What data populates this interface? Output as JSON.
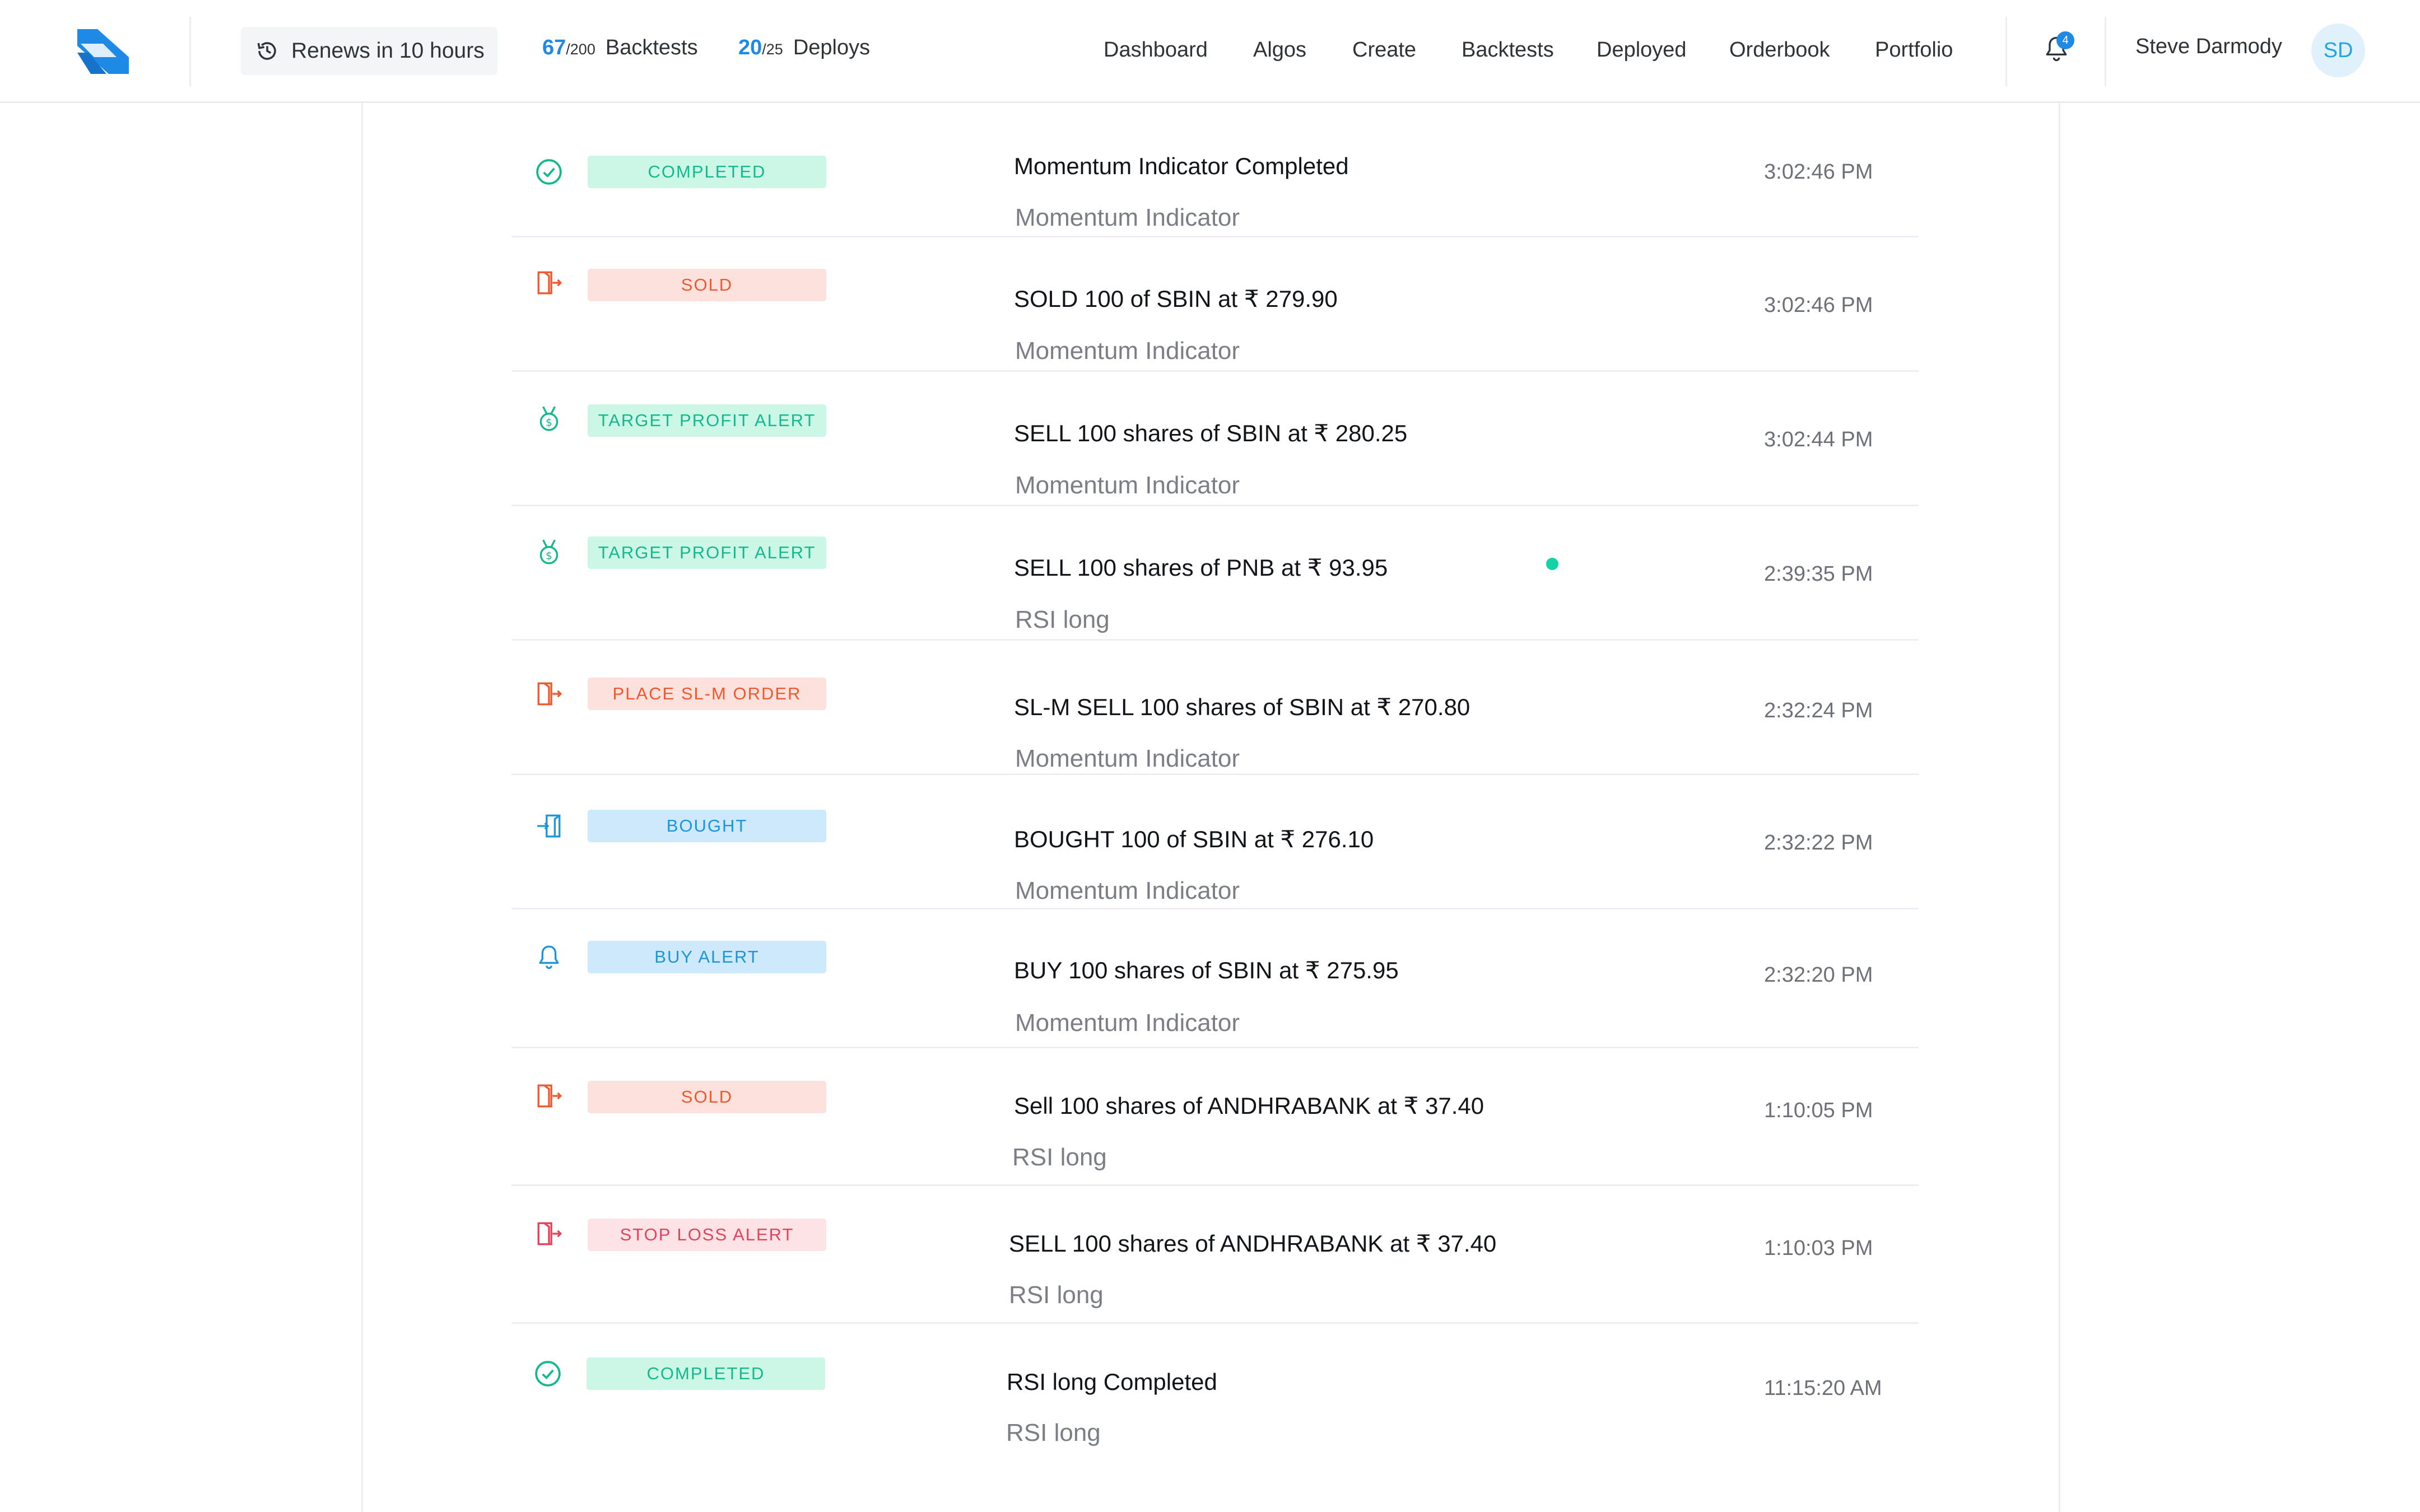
{
  "header": {
    "renew_label": "Renews in 10 hours",
    "backtests": {
      "used": "67",
      "max": "/200",
      "label": "Backtests"
    },
    "deploys": {
      "used": "20",
      "max": "/25",
      "label": "Deploys"
    },
    "nav": [
      "Dashboard",
      "Algos",
      "Create",
      "Backtests",
      "Deployed",
      "Orderbook",
      "Portfolio"
    ],
    "notifications_count": "4",
    "user_name": "Steve Darmody",
    "user_initials": "SD"
  },
  "colors": {
    "accent_blue": "#1f8ae6",
    "green": "#13b98c",
    "orange": "#f0582f",
    "blue": "#1c95db",
    "red": "#e4425a"
  },
  "feed": [
    {
      "icon": "check-circle-icon",
      "tag": "COMPLETED",
      "tone": "green",
      "title": "Momentum Indicator Completed",
      "subtitle": "Momentum Indicator",
      "time": "3:02:46 PM"
    },
    {
      "icon": "exit-door-icon",
      "tag": "SOLD",
      "tone": "orange",
      "title": "SOLD 100 of SBIN at  ₹ 279.90",
      "subtitle": "Momentum Indicator",
      "time": "3:02:46 PM"
    },
    {
      "icon": "medal-icon",
      "tag": "TARGET PROFIT ALERT",
      "tone": "green",
      "title": "SELL 100 shares of SBIN at  ₹ 280.25",
      "subtitle": "Momentum Indicator",
      "time": "3:02:44 PM"
    },
    {
      "icon": "medal-icon",
      "tag": "TARGET PROFIT ALERT",
      "tone": "green",
      "title": "SELL 100 shares of PNB at  ₹ 93.95",
      "subtitle": "RSI long",
      "time": "2:39:35 PM",
      "unread": true
    },
    {
      "icon": "exit-door-icon",
      "tag": "PLACE SL-M ORDER",
      "tone": "orange",
      "title": "SL-M SELL 100 shares of SBIN at  ₹ 270.80",
      "subtitle": "Momentum Indicator",
      "time": "2:32:24 PM"
    },
    {
      "icon": "enter-door-icon",
      "tag": "BOUGHT",
      "tone": "blue",
      "title": "BOUGHT 100 of SBIN at  ₹ 276.10",
      "subtitle": "Momentum Indicator",
      "time": "2:32:22 PM"
    },
    {
      "icon": "bell-icon",
      "tag": "BUY ALERT",
      "tone": "blue",
      "title": "BUY 100 shares of SBIN at  ₹ 275.95",
      "subtitle": "Momentum Indicator",
      "time": "2:32:20 PM"
    },
    {
      "icon": "exit-door-icon",
      "tag": "SOLD",
      "tone": "orange",
      "title": "Sell 100 shares of ANDHRABANK at  ₹ 37.40",
      "subtitle": "RSI long",
      "time": "1:10:05 PM"
    },
    {
      "icon": "exit-door-icon",
      "tag": "STOP LOSS ALERT",
      "tone": "red",
      "title": "SELL 100 shares of ANDHRABANK at  ₹ 37.40",
      "subtitle": "RSI long",
      "time": "1:10:03 PM"
    },
    {
      "icon": "check-circle-icon",
      "tag": "COMPLETED",
      "tone": "green",
      "title": "RSI long Completed",
      "subtitle": "RSI long",
      "time": "11:15:20 AM"
    }
  ]
}
